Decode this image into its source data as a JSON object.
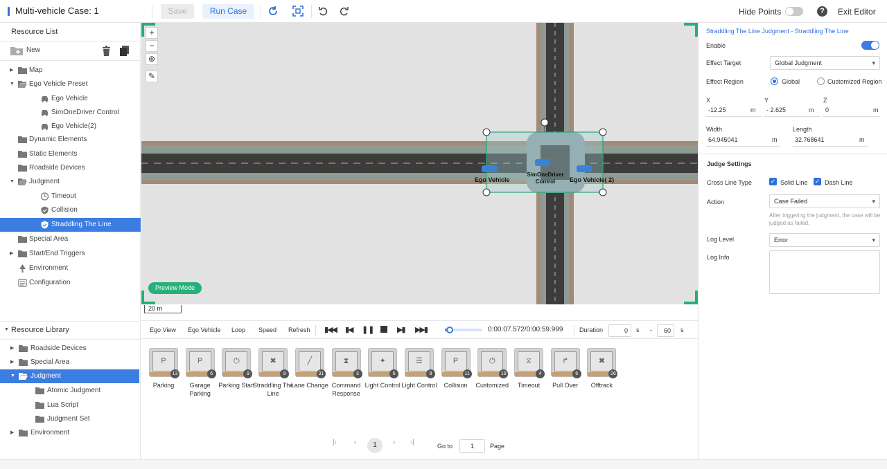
{
  "topbar": {
    "title": "Multi-vehicle Case: 1",
    "save_label": "Save",
    "run_label": "Run Case",
    "hide_points_label": "Hide Points",
    "exit_label": "Exit Editor",
    "hide_points_on": false
  },
  "left": {
    "resource_list_title": "Resource List",
    "new_label": "New",
    "tree": [
      {
        "label": "Map"
      },
      {
        "label": "Ego Vehicle Preset"
      },
      {
        "label": "Ego Vehicle"
      },
      {
        "label": "SimOneDriver Control"
      },
      {
        "label": "Ego Vehicle(2)"
      },
      {
        "label": "Dynamic Elements"
      },
      {
        "label": "Static Elements"
      },
      {
        "label": "Roadside Devices"
      },
      {
        "label": "Judgment"
      },
      {
        "label": "Timeout"
      },
      {
        "label": "Collision"
      },
      {
        "label": "Straddling The Line"
      },
      {
        "label": "Special Area"
      },
      {
        "label": "Start/End Triggers"
      },
      {
        "label": "Environment"
      },
      {
        "label": "Configuration"
      }
    ],
    "library_title": "Resource Library",
    "library_tree": [
      {
        "label": "Roadside Devices"
      },
      {
        "label": "Special Area"
      },
      {
        "label": "Judgment"
      },
      {
        "label": "Atomic Judgment"
      },
      {
        "label": "Lua Script"
      },
      {
        "label": "Judgment Set"
      },
      {
        "label": "Environment"
      }
    ]
  },
  "map": {
    "zoom_in": "+",
    "zoom_out": "−",
    "preview_label": "Preview Mode",
    "scale_label": "20 m",
    "vehicle_labels": [
      "Ego Vehicle",
      "SimOneDriver Control",
      "Ego Vehicle( 2)"
    ]
  },
  "controls": {
    "ego_view": "Ego View",
    "ego_vehicle": "Ego Vehicle",
    "loop": "Loop",
    "speed": "Speed",
    "refresh": "Refresh",
    "time": "0:00:07.572/0:00:59.999",
    "progress": 0.126,
    "duration_label": "Duration",
    "duration_start": "0",
    "duration_end": "60",
    "unit_s": "s",
    "dash": "-"
  },
  "library": [
    {
      "label": "Parking",
      "count": "13",
      "glyph": "P"
    },
    {
      "label": "Garage Parking",
      "count": "6",
      "glyph": "P"
    },
    {
      "label": "Parking Start",
      "count": "9",
      "glyph": "⏻"
    },
    {
      "label": "Straddling The Line",
      "count": "9",
      "glyph": "✖"
    },
    {
      "label": "Lane Change",
      "count": "31",
      "glyph": "╱"
    },
    {
      "label": "Command Response",
      "count": "3",
      "glyph": "⧗"
    },
    {
      "label": "Light Control",
      "count": "6",
      "glyph": "✦"
    },
    {
      "label": "Light Control",
      "count": "8",
      "glyph": "☰"
    },
    {
      "label": "Collision",
      "count": "11",
      "glyph": "P"
    },
    {
      "label": "Customized",
      "count": "19",
      "glyph": "⏻"
    },
    {
      "label": "Timeout",
      "count": "4",
      "glyph": "⧖"
    },
    {
      "label": "Pull Over",
      "count": "6",
      "glyph": "↱"
    },
    {
      "label": "Offtrack",
      "count": "26",
      "glyph": "✖"
    }
  ],
  "pagination": {
    "current": "1",
    "goto_label": "Go to",
    "goto_value": "1",
    "page_label": "Page"
  },
  "right": {
    "title": "Straddling The Line Judgment - Straddling The Line",
    "enable_label": "Enable",
    "enable_on": true,
    "effect_target_label": "Effect Target",
    "effect_target_value": "Global Judgment",
    "effect_region_label": "Effect Region",
    "region_global": "Global",
    "region_custom": "Customized Region",
    "x_label": "X",
    "y_label": "Y",
    "z_label": "Z",
    "x_value": "-12.25",
    "y_value": "- 2.625",
    "z_value": "0",
    "unit_m": "m",
    "width_label": "Width",
    "length_label": "Length",
    "width_value": "64.945041",
    "length_value": "32.768641",
    "judge_settings_title": "Judge Settings",
    "cross_line_label": "Cross Line Type",
    "solid_line": "Solid Line",
    "dash_line": "Dash Line",
    "action_label": "Action",
    "action_value": "Case Failed",
    "action_note": "After triggering the judgment, the case will be judged as failed.",
    "log_level_label": "Log Level",
    "log_level_value": "Error",
    "log_info_label": "Log Info"
  },
  "colors": {
    "accent": "#2f6fdd",
    "selected_row": "#3b7de0",
    "preview_green": "#26b07a",
    "corner_green": "#21b374"
  }
}
